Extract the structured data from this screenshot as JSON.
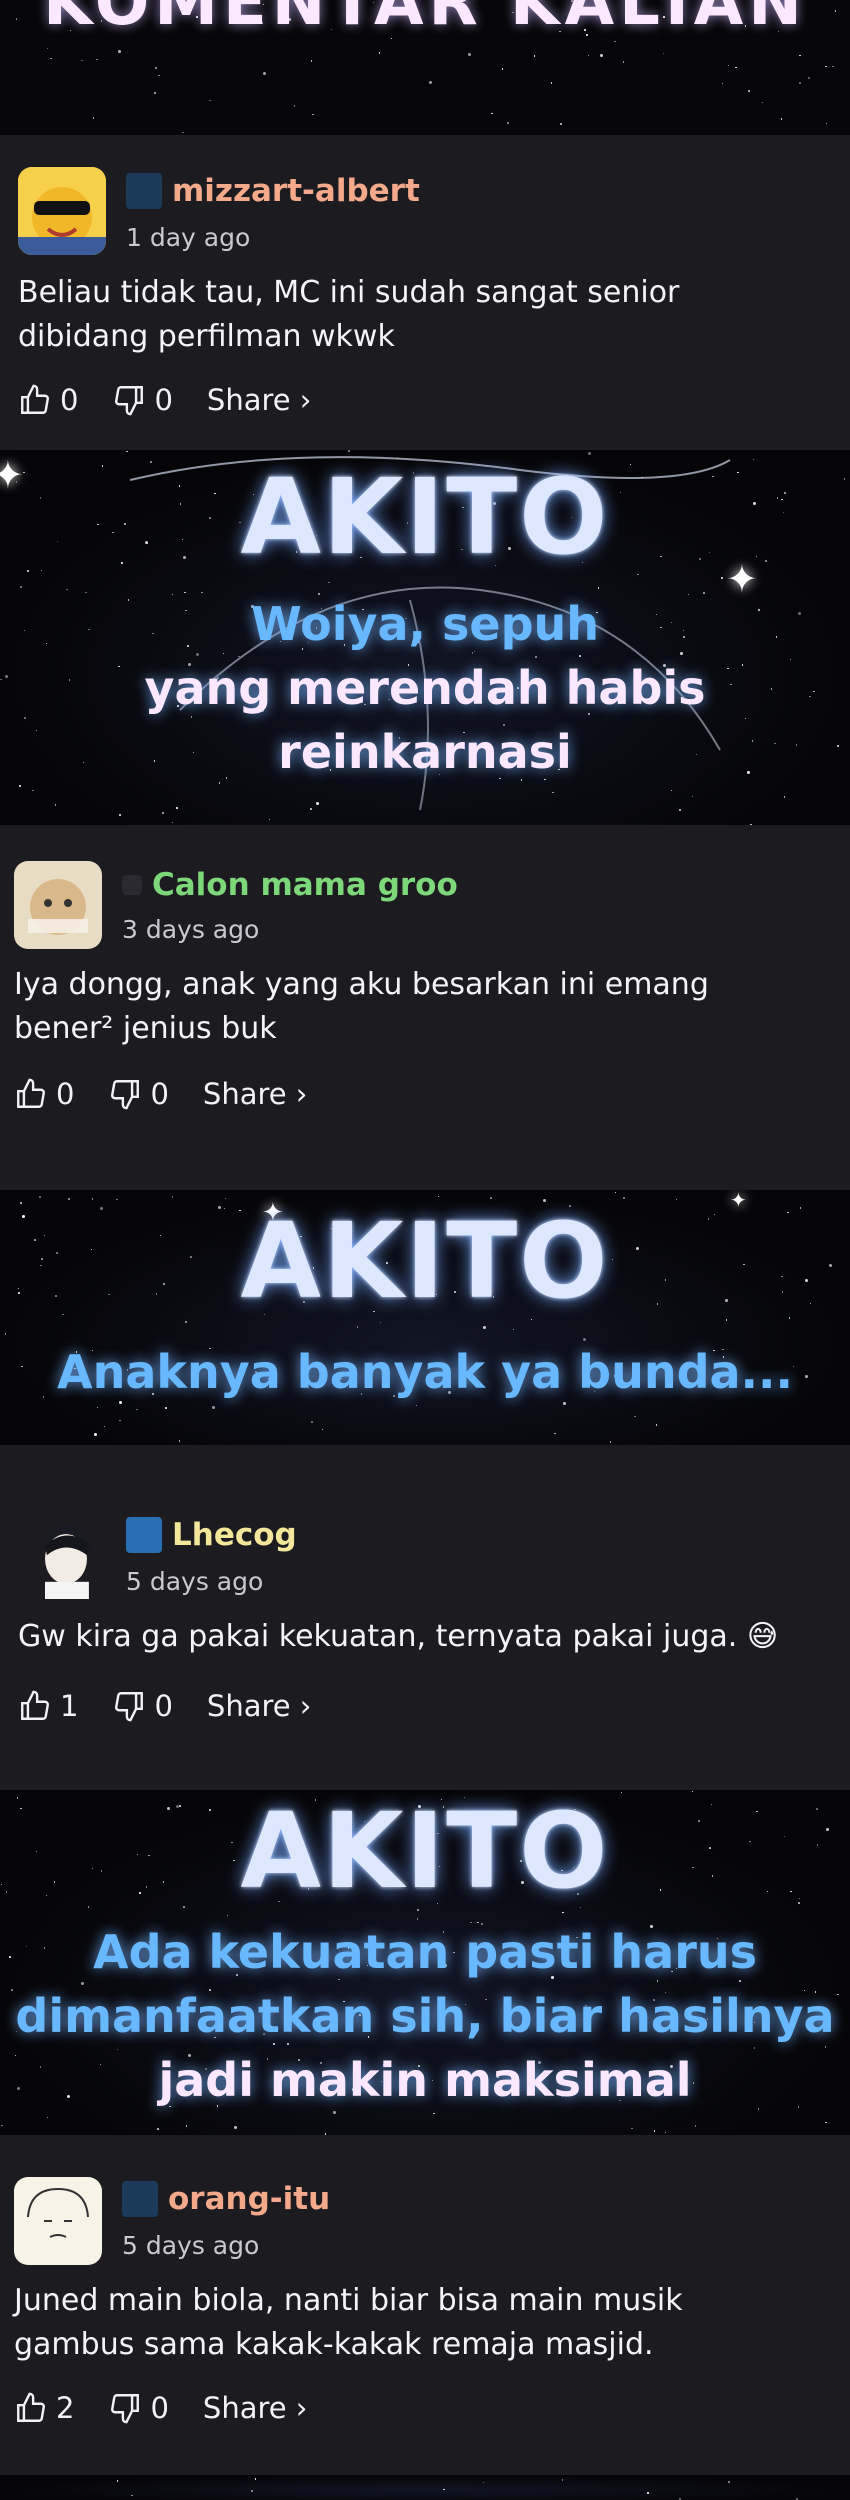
{
  "header": {
    "title": "KOMENTAR KALIAN"
  },
  "comments": [
    {
      "username": "mizzart-albert",
      "username_color": "#f4a98a",
      "age": "1 day ago",
      "text": "Beliau tidak tau, MC ini sudah sangat senior dibidang perfilman wkwk",
      "likes": "0",
      "dislikes": "0",
      "share_label": "Share ›"
    },
    {
      "username": "Calon mama groo",
      "username_color": "#7dd87a",
      "age": "3 days ago",
      "text": "Iya dongg, anak yang aku besarkan ini emang bener² jenius buk",
      "likes": "0",
      "dislikes": "0",
      "share_label": "Share ›"
    },
    {
      "username": "Lhecog",
      "username_color": "#f4e79a",
      "age": "5 days ago",
      "text": "Gw kira ga pakai kekuatan, ternyata pakai juga. 😅",
      "likes": "1",
      "dislikes": "0",
      "share_label": "Share ›"
    },
    {
      "username": "orang-itu",
      "username_color": "#f4a98a",
      "age": "5 days ago",
      "text": "Juned main biola, nanti biar bisa main musik gambus sama kakak-kakak remaja masjid.",
      "likes": "2",
      "dislikes": "0",
      "share_label": "Share ›"
    }
  ],
  "panels": [
    {
      "name": "AKITO",
      "lines": [
        "Woiya, sepuh",
        "yang merendah habis",
        "reinkarnasi"
      ]
    },
    {
      "name": "AKITO",
      "lines": [
        "Anaknya banyak ya bunda..."
      ]
    },
    {
      "name": "AKITO",
      "lines": [
        "Ada kekuatan pasti harus",
        "dimanfaatkan sih, biar hasilnya",
        "jadi makin maksimal"
      ]
    }
  ]
}
